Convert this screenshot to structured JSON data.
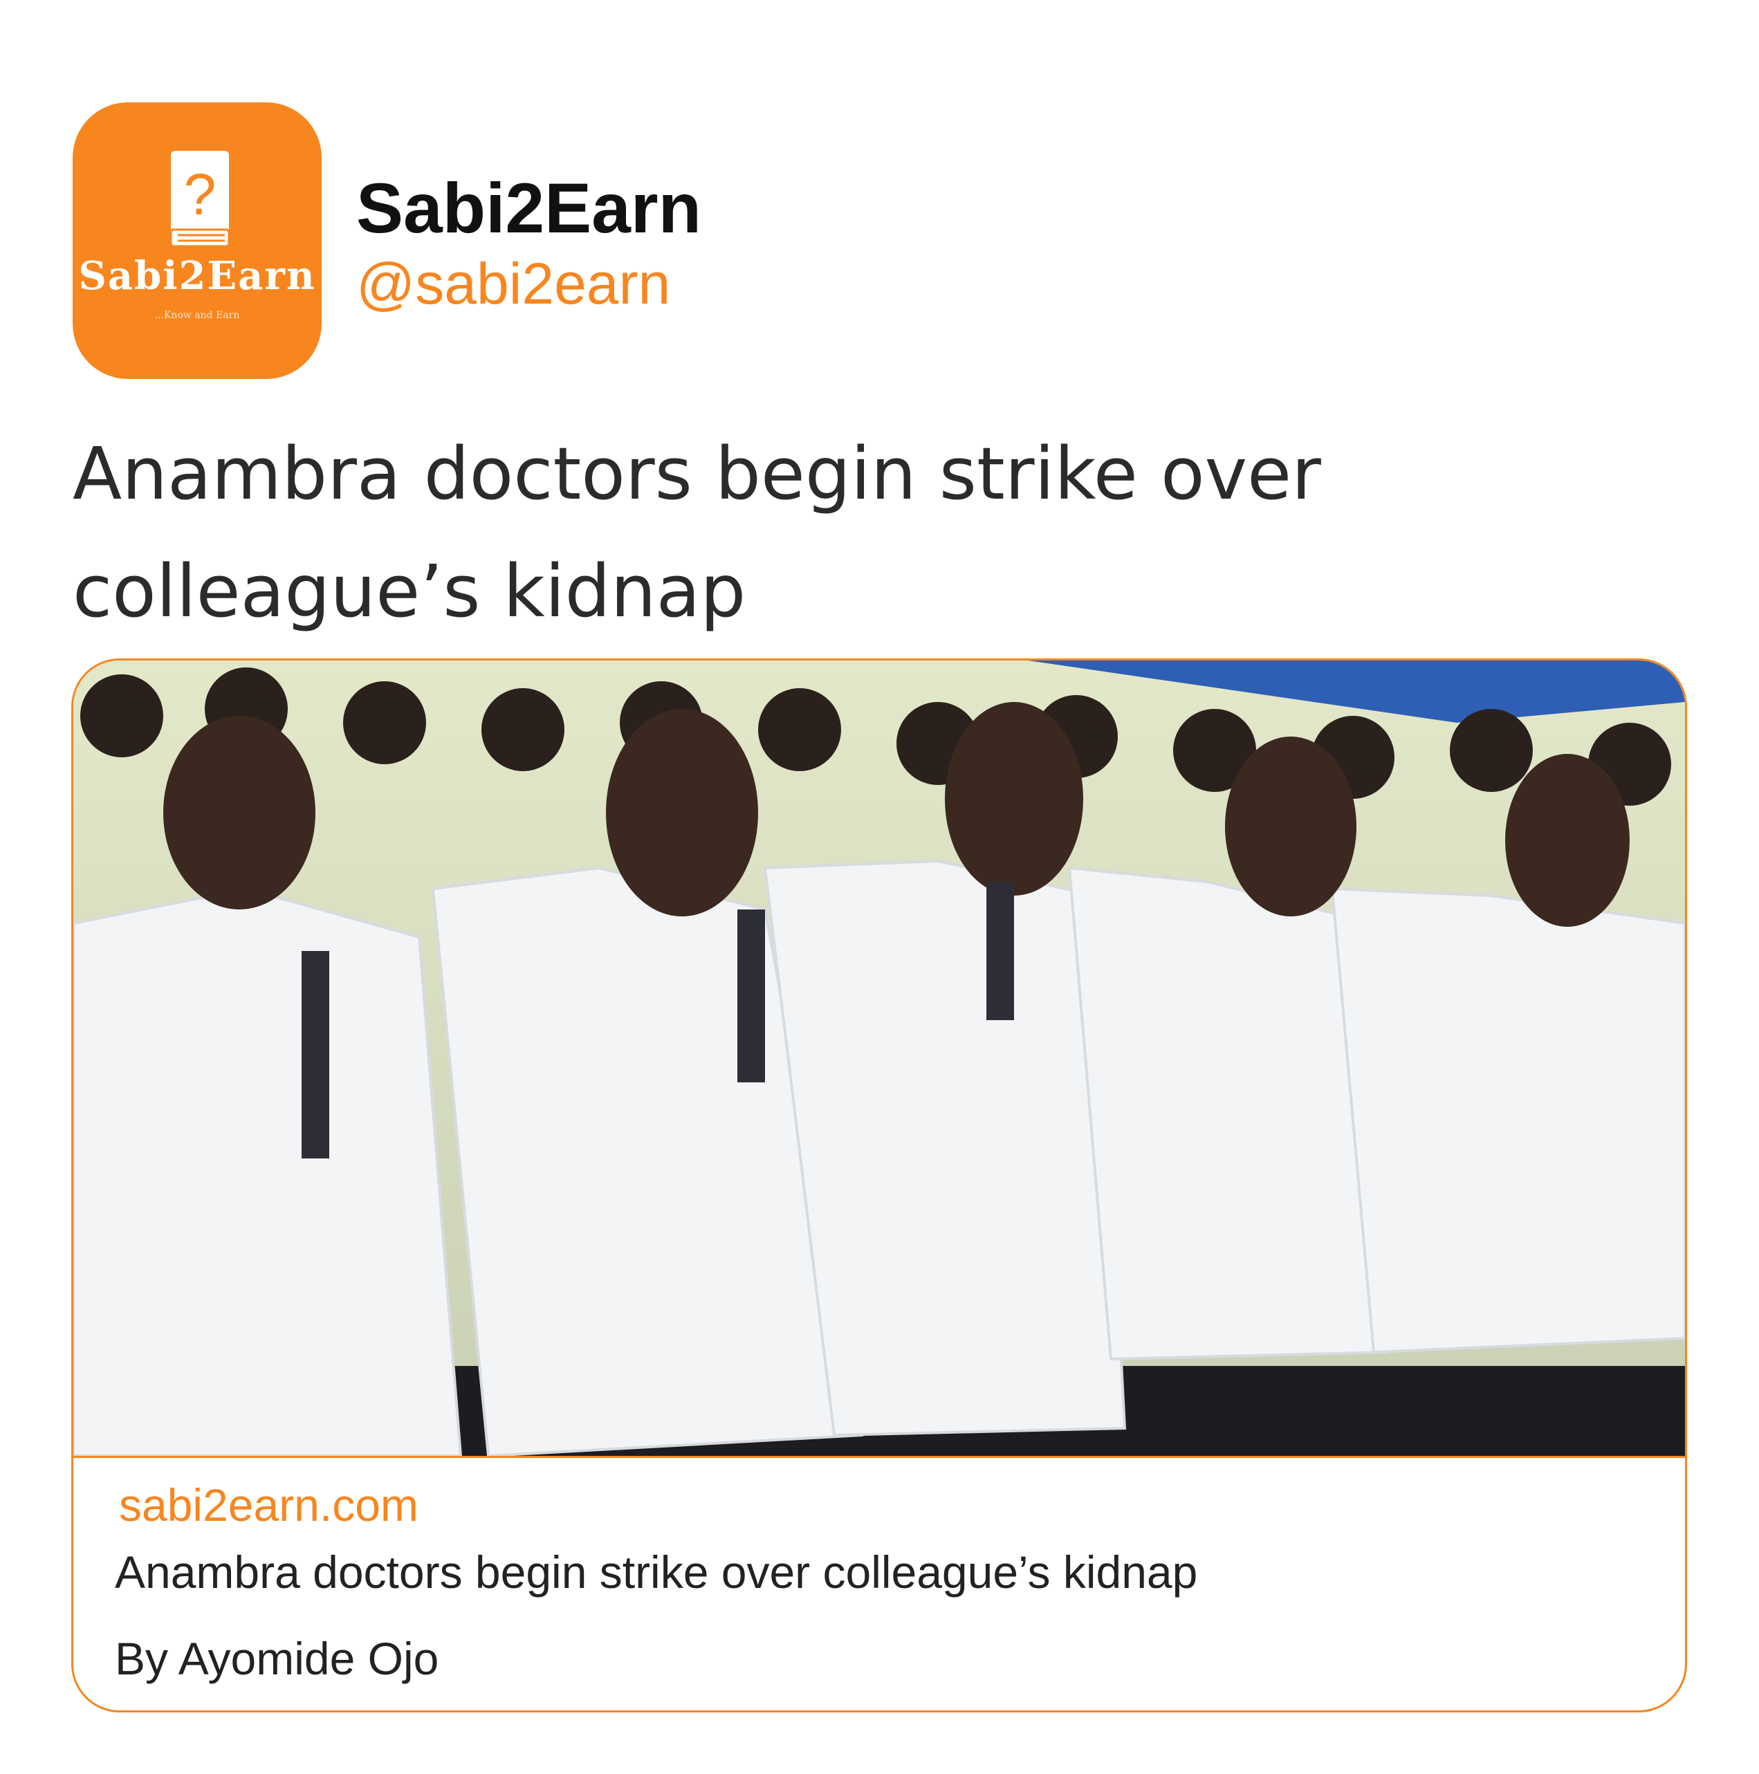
{
  "colors": {
    "accent": "#f7861f",
    "text": "#2b2b2b",
    "background": "#ffffff"
  },
  "account": {
    "avatar_logo_text": "Sabi2Earn",
    "avatar_logo_tagline": "...Know and Earn",
    "avatar_icon": "question-book-icon",
    "name": "Sabi2Earn",
    "handle": "@sabi2earn"
  },
  "tweet": {
    "text": "Anambra doctors begin strike over colleague’s kidnap"
  },
  "link_card": {
    "image_description_icon": "photo",
    "domain": "sabi2earn.com",
    "title": "Anambra doctors begin strike over colleague’s kidnap",
    "byline": "By Ayomide Ojo"
  }
}
